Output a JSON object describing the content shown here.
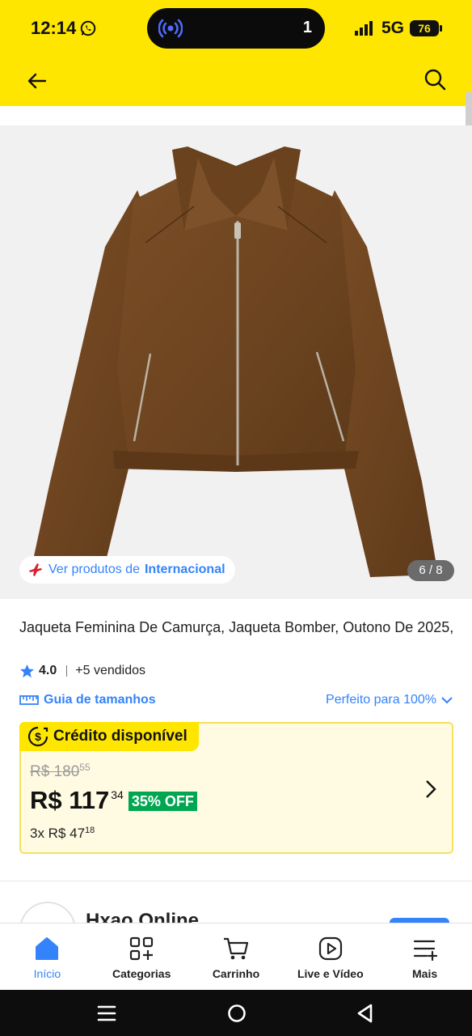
{
  "status_bar": {
    "time": "12:14",
    "notification_count": "1",
    "network": "5G",
    "battery": "76"
  },
  "header": {
    "back_icon": "back-arrow-icon",
    "search_icon": "search-icon"
  },
  "gallery": {
    "intl_prefix": "Ver produtos de",
    "intl_highlight": "Internacional",
    "counter": "6 / 8"
  },
  "product": {
    "title": "Jaqueta Feminina De Camurça, Jaqueta Bomber, Outono De 2025,",
    "rating": "4.0",
    "sold": "+5 vendidos",
    "size_guide": "Guia de tamanhos",
    "fit": "Perfeito para 100%"
  },
  "credit": {
    "label": "Crédito disponível",
    "old_currency_int": "R$ 180",
    "old_cents": "55",
    "price_int": "R$ 117",
    "price_cents": "34",
    "discount": "35% OFF",
    "installments_prefix": "3x R$ 47",
    "installments_cents": "18"
  },
  "seller": {
    "name": "Hxao Online"
  },
  "bottom_nav": {
    "items": [
      {
        "label": "Início",
        "icon": "home-icon"
      },
      {
        "label": "Categorias",
        "icon": "categories-icon"
      },
      {
        "label": "Carrinho",
        "icon": "cart-icon"
      },
      {
        "label": "Live e Vídeo",
        "icon": "video-icon"
      },
      {
        "label": "Mais",
        "icon": "menu-icon"
      }
    ]
  },
  "colors": {
    "brand_yellow": "#ffe600",
    "accent_blue": "#3483fa",
    "discount_green": "#00a650"
  }
}
